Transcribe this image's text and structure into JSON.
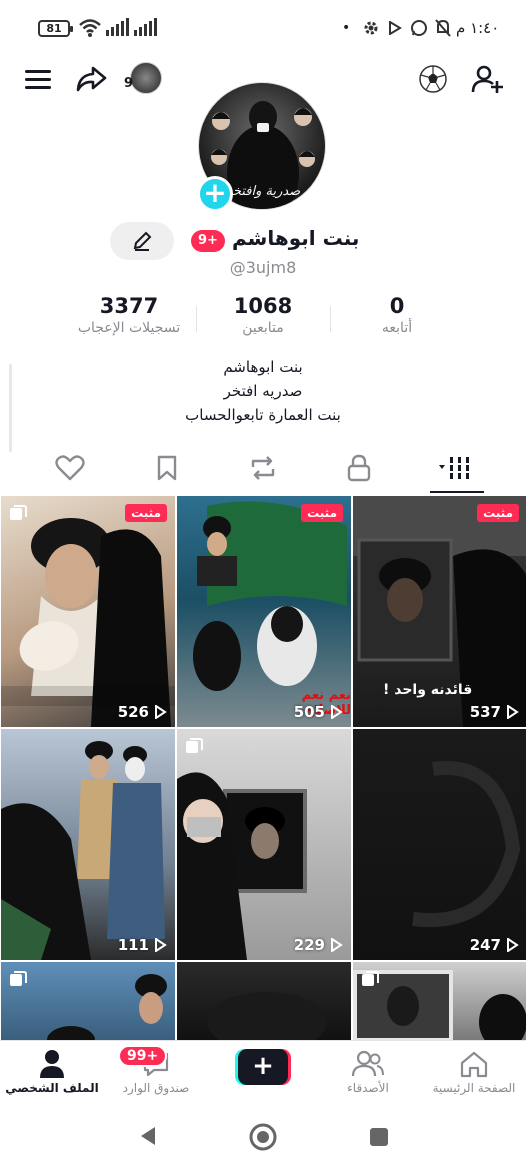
{
  "status_bar": {
    "time": "١:٤٠ م",
    "battery": "81"
  },
  "profile": {
    "display_name": "بنت ابوهاشم",
    "badge": "9+",
    "handle": "@3ujm8",
    "avatar_caption": "صدرية وافتخر",
    "header_avatar_count": "9",
    "stats": [
      {
        "value": "3377",
        "label": "تسجيلات الإعجاب"
      },
      {
        "value": "1068",
        "label": "متابعين"
      },
      {
        "value": "0",
        "label": "أتابعه"
      }
    ],
    "bio_lines": [
      "بنت ابوهاشم",
      "صدريه افتخر",
      "بنت العمارة تابعوالحساب"
    ]
  },
  "videos": [
    {
      "views": "526",
      "pinned_label": "مثبت",
      "pinned": true,
      "caption": ""
    },
    {
      "views": "505",
      "pinned_label": "مثبت",
      "pinned": true,
      "caption": "نعم نعم للاصلاح"
    },
    {
      "views": "537",
      "pinned_label": "مثبت",
      "pinned": true,
      "caption": "قائدنه واحد !"
    },
    {
      "views": "111",
      "pinned": false,
      "caption": ""
    },
    {
      "views": "229",
      "pinned": false,
      "caption": ""
    },
    {
      "views": "247",
      "pinned": false,
      "caption": ""
    }
  ],
  "bottom_nav": {
    "profile": "الملف الشخصي",
    "inbox": "صندوق الوارد",
    "inbox_badge": "99+",
    "create": "+",
    "friends": "الأصدقاء",
    "home": "الصفحة الرئيسية"
  },
  "colors": {
    "accent_red": "#fe2c55",
    "accent_cyan": "#20d5ec",
    "text": "#161823",
    "muted": "#8a8b91"
  }
}
